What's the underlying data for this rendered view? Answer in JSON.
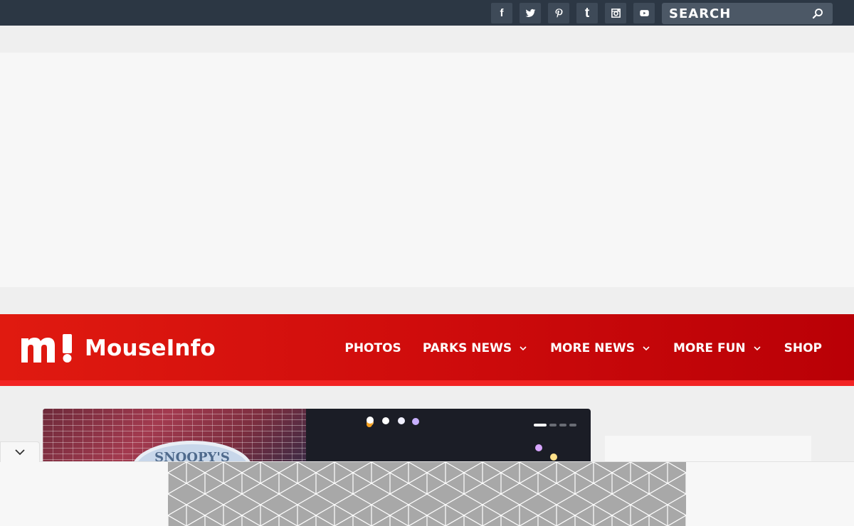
{
  "topbar": {
    "social": [
      {
        "name": "facebook-icon",
        "glyph": "f"
      },
      {
        "name": "twitter-icon",
        "glyph": ""
      },
      {
        "name": "pinterest-icon",
        "glyph": "P"
      },
      {
        "name": "tumblr-icon",
        "glyph": "t"
      },
      {
        "name": "instagram-icon",
        "glyph": ""
      },
      {
        "name": "youtube-icon",
        "glyph": ""
      }
    ],
    "search": {
      "placeholder": "SEARCH"
    }
  },
  "header": {
    "logo_mark": "m!",
    "logo_text": "MouseInfo",
    "nav": [
      {
        "label": "PHOTOS",
        "dropdown": false
      },
      {
        "label": "PARKS NEWS",
        "dropdown": true
      },
      {
        "label": "MORE NEWS",
        "dropdown": true
      },
      {
        "label": "MORE FUN",
        "dropdown": true
      },
      {
        "label": "SHOP",
        "dropdown": false
      }
    ]
  },
  "slider": {
    "sign_text": "SNOOPY'S",
    "slide_count": 4,
    "active_slide": 1
  },
  "colors": {
    "topbar": "#2c3744",
    "header_red": "#d40f0c",
    "accent_stripe": "#f22424"
  }
}
